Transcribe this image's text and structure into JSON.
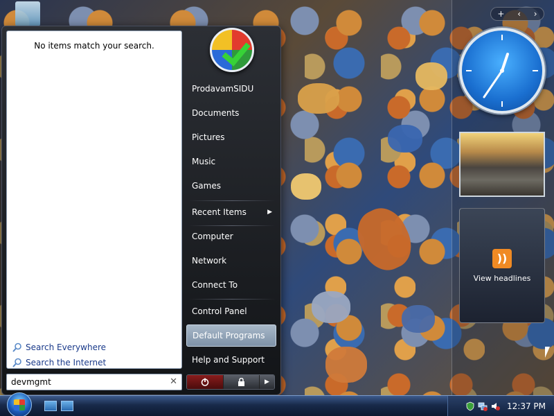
{
  "start_menu": {
    "no_results": "No items match your search.",
    "search_links": [
      {
        "label": "Search Everywhere"
      },
      {
        "label": "Search the Internet"
      }
    ],
    "search_value": "devmgmt",
    "right_items": [
      {
        "label": "ProdavamSIDU"
      },
      {
        "label": "Documents"
      },
      {
        "label": "Pictures"
      },
      {
        "label": "Music"
      },
      {
        "label": "Games"
      },
      {
        "label": "Recent Items"
      },
      {
        "label": "Computer"
      },
      {
        "label": "Network"
      },
      {
        "label": "Connect To"
      },
      {
        "label": "Control Panel"
      },
      {
        "label": "Default Programs"
      },
      {
        "label": "Help and Support"
      }
    ]
  },
  "sidebar": {
    "feeds_label": "View headlines"
  },
  "taskbar": {
    "clock": "12:37 PM"
  },
  "colors": {
    "accent": "#1a6fd0",
    "selected_item": "#8ea0b6",
    "link": "#1a3a8a"
  },
  "icons": [
    "recycle-bin-icon",
    "windows-logo-icon",
    "search-icon",
    "power-icon",
    "lock-icon",
    "rss-icon",
    "clock-icon",
    "network-icon",
    "volume-icon"
  ]
}
